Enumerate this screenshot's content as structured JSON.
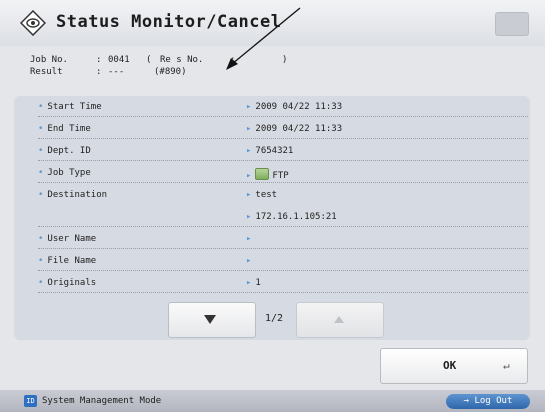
{
  "header": {
    "title": "Status Monitor/Cancel"
  },
  "job": {
    "job_no_label": "Job No.",
    "job_no_colon": ":",
    "job_no_value": "0041",
    "paren_open": "(",
    "reserve_label": "Re  s No.",
    "reserve_colon": ":",
    "paren_close": ")",
    "result_label": "Result",
    "result_colon": ":",
    "result_value": "---",
    "result_code": "(#890)"
  },
  "details": [
    {
      "label": "Start Time",
      "value": "2009 04/22 11:33"
    },
    {
      "label": "End Time",
      "value": "2009 04/22 11:33"
    },
    {
      "label": "Dept. ID",
      "value": "7654321"
    },
    {
      "label": "Job Type",
      "value": "FTP"
    },
    {
      "label": "Destination",
      "value": "test"
    },
    {
      "label": "",
      "value": "172.16.1.105:21"
    },
    {
      "label": "User Name",
      "value": ""
    },
    {
      "label": "File Name",
      "value": ""
    },
    {
      "label": "Originals",
      "value": "1"
    }
  ],
  "pager": {
    "page": "1/2"
  },
  "buttons": {
    "ok": "OK",
    "enter_icon": "↵",
    "logout": "Log Out",
    "logout_icon": "→"
  },
  "status_bar": {
    "mode": "System Management Mode",
    "icon_text": "ID"
  },
  "icons": {
    "title_icon": "eye-diamond-icon",
    "ftp_icon": "ftp-folder-icon",
    "down_icon": "triangle-down-icon",
    "up_icon": "triangle-up-icon"
  }
}
